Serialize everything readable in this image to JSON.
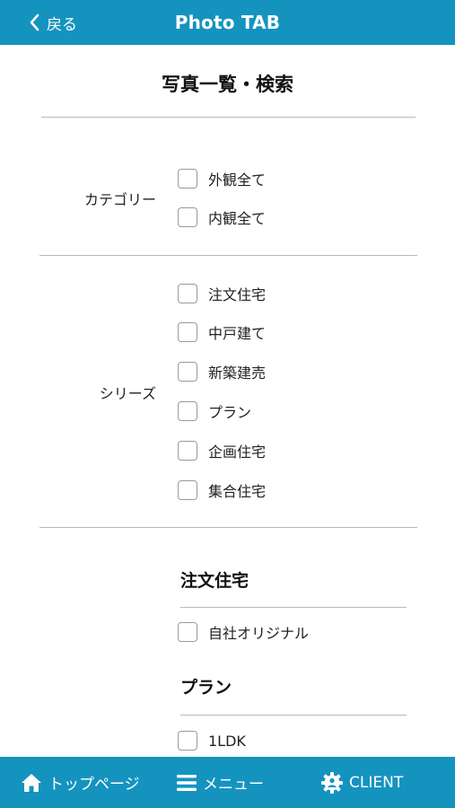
{
  "header": {
    "back_label": "戻る",
    "title": "Photo TAB"
  },
  "page_title": "写真一覧・検索",
  "category": {
    "label": "カテゴリー",
    "options": [
      {
        "label": "外観全て",
        "checked": false
      },
      {
        "label": "内観全て",
        "checked": false
      }
    ]
  },
  "series": {
    "label": "シリーズ",
    "options": [
      {
        "label": "注文住宅",
        "checked": false
      },
      {
        "label": "中戸建て",
        "checked": false
      },
      {
        "label": "新築建売",
        "checked": false
      },
      {
        "label": "プラン",
        "checked": false
      },
      {
        "label": "企画住宅",
        "checked": false
      },
      {
        "label": "集合住宅",
        "checked": false
      }
    ]
  },
  "sub_sections": [
    {
      "title": "注文住宅",
      "options": [
        {
          "label": "自社オリジナル",
          "checked": false
        }
      ]
    },
    {
      "title": "プラン",
      "options": [
        {
          "label": "1LDK",
          "checked": false
        }
      ]
    }
  ],
  "footer": {
    "home_label": "トップページ",
    "menu_label": "メニュー",
    "client_label": "CLIENT"
  },
  "colors": {
    "accent": "#1593bf",
    "divider": "#b9b9b9",
    "checkbox_border": "#9a9a9a"
  }
}
